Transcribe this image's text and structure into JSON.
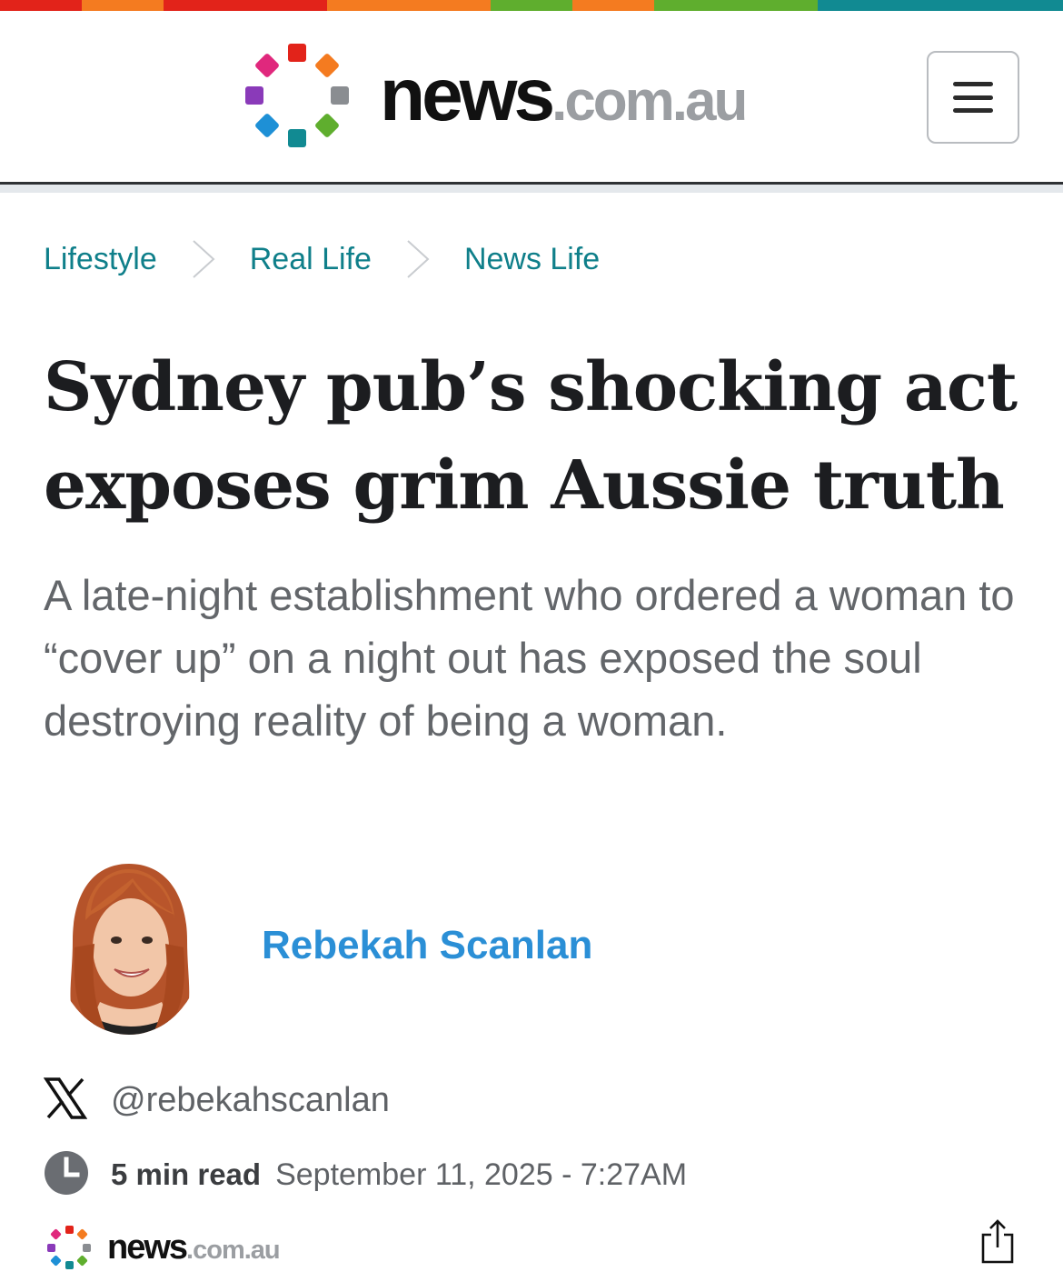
{
  "brand": {
    "name": "news",
    "domain": ".com.au",
    "stripe_colors": [
      "#e2231a",
      "#f47b20",
      "#e2231a",
      "#e2231a",
      "#f47b20",
      "#f47b20",
      "#5fae2e",
      "#f47b20",
      "#5fae2e",
      "#5fae2e",
      "#118a92",
      "#118a92",
      "#118a92"
    ],
    "dot_colors": [
      "#e2231a",
      "#f47b20",
      "#8a8d91",
      "#5fae2e",
      "#118a92",
      "#1e90d6",
      "#8a3ab9",
      "#e0287d"
    ]
  },
  "header": {
    "menu_icon": "hamburger-icon"
  },
  "breadcrumb": {
    "items": [
      {
        "label": "Lifestyle"
      },
      {
        "label": "Real Life"
      },
      {
        "label": "News Life"
      }
    ],
    "separator_icon": "chevron-right-icon"
  },
  "article": {
    "headline": "Sydney pub’s shocking act exposes grim Aussie truth",
    "standfirst": "A late-night establishment who ordered a woman to “cover up” on a night out has exposed the soul destroying reality of being a woman.",
    "author": {
      "name": "Rebekah Scanlan",
      "avatar_icon": "author-avatar",
      "social_icon": "x-logo-icon",
      "social_handle": "@rebekahscanlan"
    },
    "meta": {
      "clock_icon": "clock-icon",
      "read_time": "5 min read",
      "date": "September 11, 2025 - 7:27AM"
    }
  },
  "footer": {
    "share_icon": "share-icon"
  },
  "colors": {
    "link_teal": "#0f7f8a",
    "author_blue": "#2b8fd6",
    "headline": "#1c1d20",
    "body_grey": "#63666a"
  }
}
